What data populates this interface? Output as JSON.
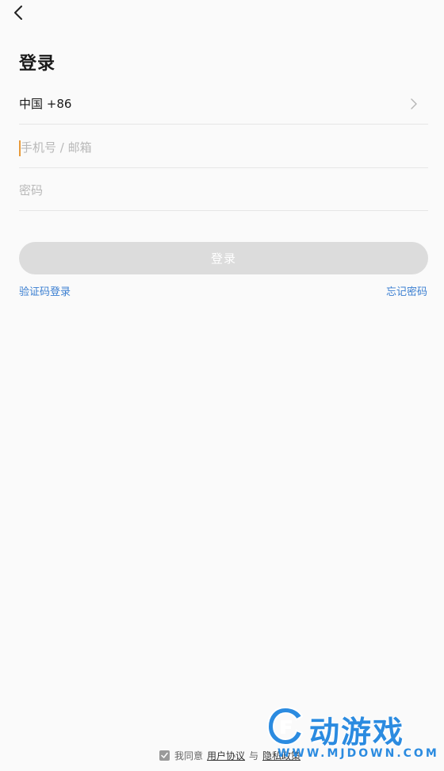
{
  "header": {
    "back_icon": "chevron-left-icon",
    "title": "登录"
  },
  "form": {
    "country": {
      "value": "中国 +86",
      "icon": "chevron-right-icon"
    },
    "phone": {
      "value": "",
      "placeholder": "手机号 / 邮箱"
    },
    "password": {
      "value": "",
      "placeholder": "密码"
    },
    "login_button": "登录"
  },
  "links": {
    "sms_login": "验证码登录",
    "forgot_password": "忘记密码"
  },
  "footer": {
    "agree_prefix": "我同意",
    "user_agreement": "用户协议",
    "conjunction": "与",
    "privacy_policy": "隐私政策",
    "checkbox_checked": true
  },
  "watermark": {
    "name": "动游戏",
    "url": "WWW.MJDOWN.COM"
  },
  "colors": {
    "accent": "#3b7fd1",
    "caret": "#e89a3a",
    "button_disabled": "#dcdcdc",
    "background": "#fafafa",
    "watermark": "#2b8be0"
  }
}
